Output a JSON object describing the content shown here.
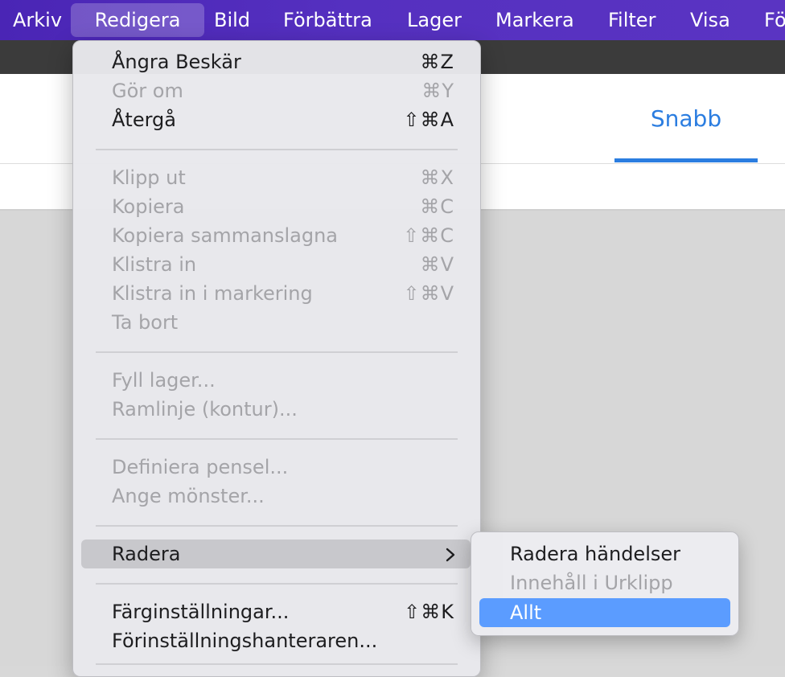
{
  "menubar": {
    "items": [
      "Arkiv",
      "Redigera",
      "Bild",
      "Förbättra",
      "Lager",
      "Markera",
      "Filter",
      "Visa",
      "Fö"
    ],
    "active_index": 1
  },
  "toolbar": {
    "tab_snabb": "Snabb"
  },
  "edit_menu": {
    "items": [
      {
        "label": "Ångra Beskär",
        "shortcut": "⌘Z",
        "enabled": true
      },
      {
        "label": "Gör om",
        "shortcut": "⌘Y",
        "enabled": false
      },
      {
        "label": "Återgå",
        "shortcut": "⇧⌘A",
        "enabled": true
      },
      {
        "label": "Klipp ut",
        "shortcut": "⌘X",
        "enabled": false
      },
      {
        "label": "Kopiera",
        "shortcut": "⌘C",
        "enabled": false
      },
      {
        "label": "Kopiera sammanslagna",
        "shortcut": "⇧⌘C",
        "enabled": false
      },
      {
        "label": "Klistra in",
        "shortcut": "⌘V",
        "enabled": false
      },
      {
        "label": "Klistra in i markering",
        "shortcut": "⇧⌘V",
        "enabled": false
      },
      {
        "label": "Ta bort",
        "shortcut": "",
        "enabled": false
      },
      {
        "label": "Fyll lager...",
        "shortcut": "",
        "enabled": false
      },
      {
        "label": "Ramlinje (kontur)...",
        "shortcut": "",
        "enabled": false
      },
      {
        "label": "Definiera pensel...",
        "shortcut": "",
        "enabled": false
      },
      {
        "label": "Ange mönster...",
        "shortcut": "",
        "enabled": false
      },
      {
        "label": "Radera",
        "shortcut": "",
        "enabled": true,
        "submenu": true,
        "highlighted": true
      },
      {
        "label": "Färginställningar...",
        "shortcut": "⇧⌘K",
        "enabled": true
      },
      {
        "label": "Förinställningshanteraren...",
        "shortcut": "",
        "enabled": true
      }
    ],
    "submenu_arrow": "chevron-right-icon"
  },
  "radera_submenu": {
    "items": [
      {
        "label": "Radera händelser",
        "enabled": true
      },
      {
        "label": "Innehåll i Urklipp",
        "enabled": false
      },
      {
        "label": "Allt",
        "enabled": true,
        "selected": true
      }
    ]
  },
  "colors": {
    "menubar_bg": "#5530c0",
    "accent_blue": "#2b7de0",
    "selection_blue": "#5b9cff"
  }
}
